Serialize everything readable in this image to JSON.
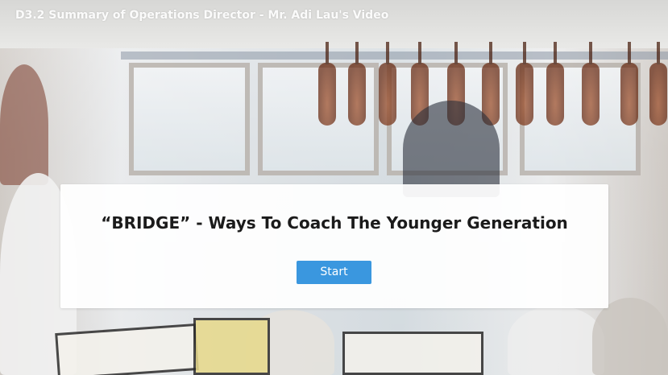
{
  "header": {
    "title": "D3.2 Summary of Operations Director - Mr. Adi Lau's Video"
  },
  "card": {
    "title": "“BRIDGE”  - Ways To Coach The Younger Generation",
    "start_label": "Start"
  },
  "colors": {
    "start_button": "#3a97df",
    "card_background": "#ffffff",
    "title_text": "#1b1b1b"
  }
}
